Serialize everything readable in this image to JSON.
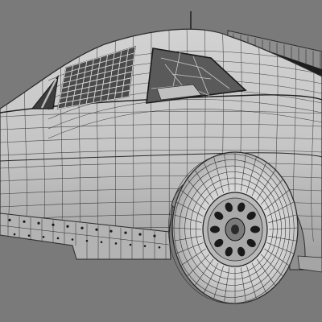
{
  "scene": {
    "subject": "race-car-rear-wireframe",
    "background_color": "#7a7a7a",
    "body_color": "#c9c9c9",
    "body_shadow_color": "#9c9c9c",
    "wire_color": "#2a2a2a",
    "tire_color": "#d4d4d4",
    "window_dark_color": "#3a3a3a"
  }
}
